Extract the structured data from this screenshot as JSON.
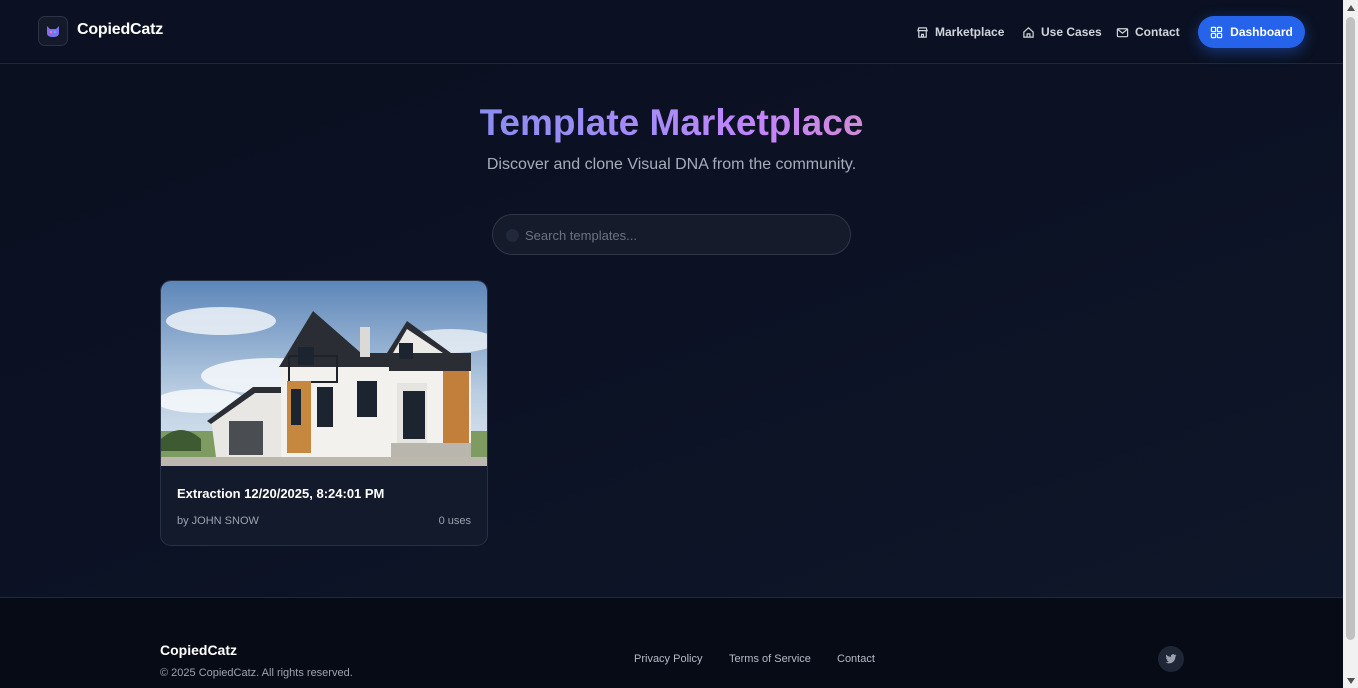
{
  "header": {
    "brand": "CopiedCatz",
    "nav": [
      {
        "label": "Marketplace",
        "icon": "store-icon"
      },
      {
        "label": "Use Cases",
        "icon": "home-icon"
      },
      {
        "label": "Contact",
        "icon": "mail-icon"
      }
    ],
    "dashboard_label": "Dashboard"
  },
  "hero": {
    "title": "Template Marketplace",
    "subtitle": "Discover and clone Visual DNA from the community."
  },
  "search": {
    "placeholder": "Search templates..."
  },
  "templates": [
    {
      "title": "Extraction 12/20/2025, 8:24:01 PM",
      "author": "by JOHN SNOW",
      "uses": "0 uses"
    }
  ],
  "footer": {
    "brand": "CopiedCatz",
    "copyright": "© 2025 CopiedCatz. All rights reserved.",
    "links": [
      "Privacy Policy",
      "Terms of Service",
      "Contact"
    ]
  },
  "colors": {
    "accent": "#2563eb",
    "background": "#0b1020",
    "title_gradient_start": "#8b8cf0",
    "title_gradient_end": "#d08ad8"
  }
}
